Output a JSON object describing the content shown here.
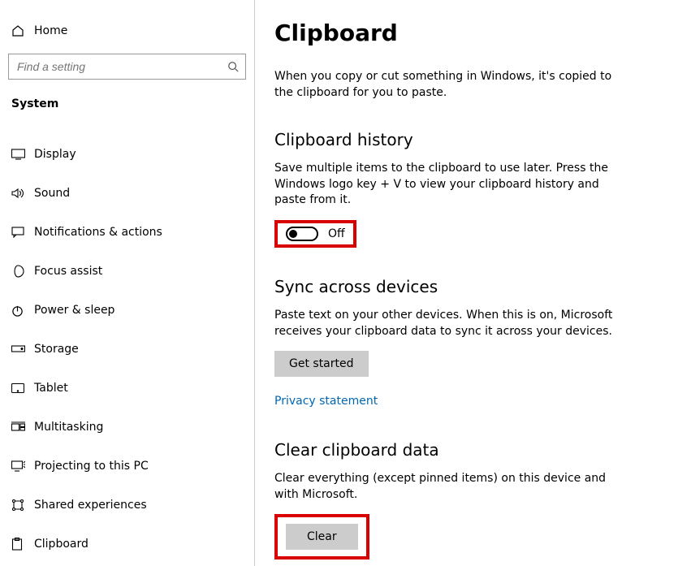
{
  "sidebar": {
    "home": "Home",
    "search_placeholder": "Find a setting",
    "section": "System",
    "items": [
      {
        "label": "Display"
      },
      {
        "label": "Sound"
      },
      {
        "label": "Notifications & actions"
      },
      {
        "label": "Focus assist"
      },
      {
        "label": "Power & sleep"
      },
      {
        "label": "Storage"
      },
      {
        "label": "Tablet"
      },
      {
        "label": "Multitasking"
      },
      {
        "label": "Projecting to this PC"
      },
      {
        "label": "Shared experiences"
      },
      {
        "label": "Clipboard"
      }
    ]
  },
  "main": {
    "title": "Clipboard",
    "intro": "When you copy or cut something in Windows, it's copied to the clipboard for you to paste.",
    "history": {
      "heading": "Clipboard history",
      "desc": "Save multiple items to the clipboard to use later. Press the Windows logo key + V to view your clipboard history and paste from it.",
      "toggle_label": "Off"
    },
    "sync": {
      "heading": "Sync across devices",
      "desc": "Paste text on your other devices. When this is on, Microsoft receives your clipboard data to sync it across your devices.",
      "button": "Get started",
      "link": "Privacy statement"
    },
    "clear": {
      "heading": "Clear clipboard data",
      "desc": "Clear everything (except pinned items) on this device and with Microsoft.",
      "button": "Clear"
    }
  }
}
